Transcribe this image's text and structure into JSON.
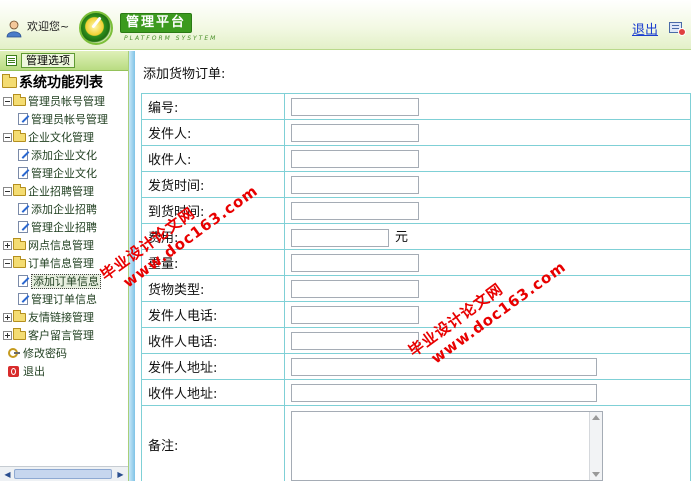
{
  "header": {
    "welcome_text": "欢迎您~",
    "brand_title": "管理平台",
    "brand_subtitle": "PLATFORM SYSYTEM",
    "logout_label": "退出",
    "accent_color": "#3c9a1f"
  },
  "sidebar": {
    "options_button_label": "管理选项",
    "root_label": "系统功能列表",
    "groups": [
      {
        "label": "管理员帐号管理",
        "expanded": true,
        "items": [
          {
            "label": "管理员帐号管理"
          }
        ]
      },
      {
        "label": "企业文化管理",
        "expanded": true,
        "items": [
          {
            "label": "添加企业文化"
          },
          {
            "label": "管理企业文化"
          }
        ]
      },
      {
        "label": "企业招聘管理",
        "expanded": true,
        "items": [
          {
            "label": "添加企业招聘"
          },
          {
            "label": "管理企业招聘"
          }
        ]
      },
      {
        "label": "网点信息管理",
        "expanded": false,
        "items": []
      },
      {
        "label": "订单信息管理",
        "expanded": true,
        "items": [
          {
            "label": "添加订单信息",
            "selected": true
          },
          {
            "label": "管理订单信息"
          }
        ]
      },
      {
        "label": "友情链接管理",
        "expanded": false,
        "items": []
      },
      {
        "label": "客户留言管理",
        "expanded": false,
        "items": []
      }
    ],
    "extra_items": [
      {
        "label": "修改密码",
        "icon": "key-icon"
      },
      {
        "label": "退出",
        "icon": "exit-icon"
      }
    ]
  },
  "main": {
    "page_title": "添加货物订单:",
    "fields": [
      {
        "label": "编号:",
        "value": ""
      },
      {
        "label": "发件人:",
        "value": ""
      },
      {
        "label": "收件人:",
        "value": ""
      },
      {
        "label": "发货时间:",
        "value": ""
      },
      {
        "label": "到货时间:",
        "value": ""
      },
      {
        "label": "费用:",
        "value": "",
        "unit": "元"
      },
      {
        "label": "重量:",
        "value": ""
      },
      {
        "label": "货物类型:",
        "value": ""
      },
      {
        "label": "发件人电话:",
        "value": ""
      },
      {
        "label": "收件人电话:",
        "value": ""
      },
      {
        "label": "发件人地址:",
        "value": ""
      },
      {
        "label": "收件人地址:",
        "value": ""
      },
      {
        "label": "备注:",
        "value": ""
      }
    ]
  },
  "watermarks": [
    {
      "cn": "毕业设计论文网",
      "url": "www.doc163.com"
    },
    {
      "cn": "毕业设计论文网",
      "url": "www.doc163.com"
    }
  ]
}
